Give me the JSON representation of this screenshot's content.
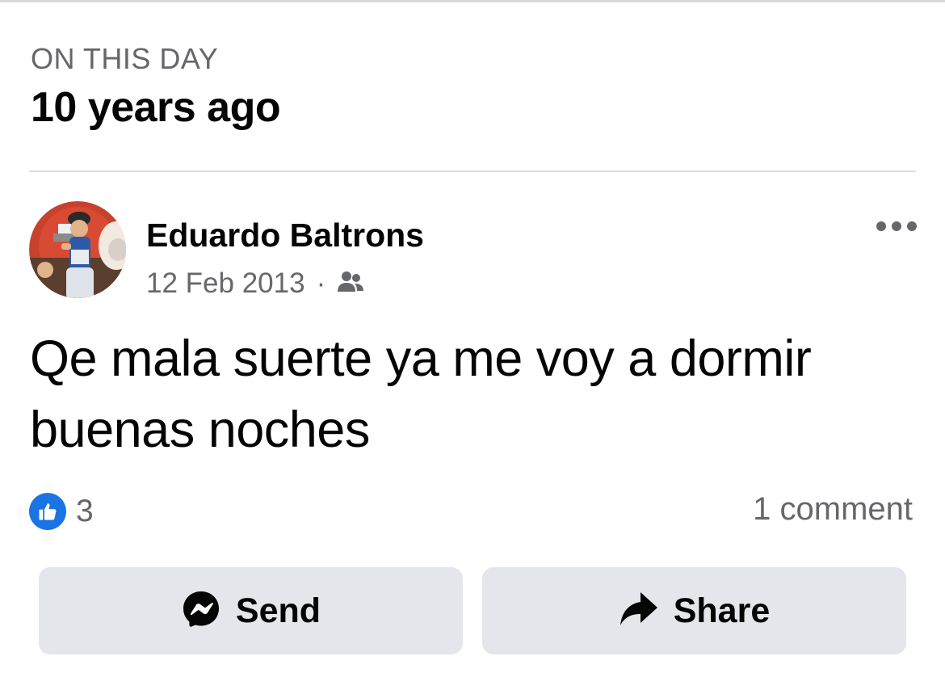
{
  "section": {
    "label": "ON THIS DAY",
    "title": "10 years ago"
  },
  "post": {
    "author": "Eduardo Baltrons",
    "date": "12 Feb 2013",
    "separator": "·",
    "audience_icon": "friends-icon",
    "text": "Qe mala suerte ya me voy a dormir buenas noches",
    "reactions": {
      "icon": "like-icon",
      "count": "3",
      "color": "#1b74e4"
    },
    "comments": "1 comment"
  },
  "actions": {
    "send_label": "Send",
    "send_icon": "messenger-icon",
    "share_label": "Share",
    "share_icon": "share-arrow-icon"
  },
  "colors": {
    "text_primary": "#050505",
    "text_secondary": "#65676b",
    "button_bg": "#e4e6eb",
    "like_blue": "#1b74e4"
  }
}
